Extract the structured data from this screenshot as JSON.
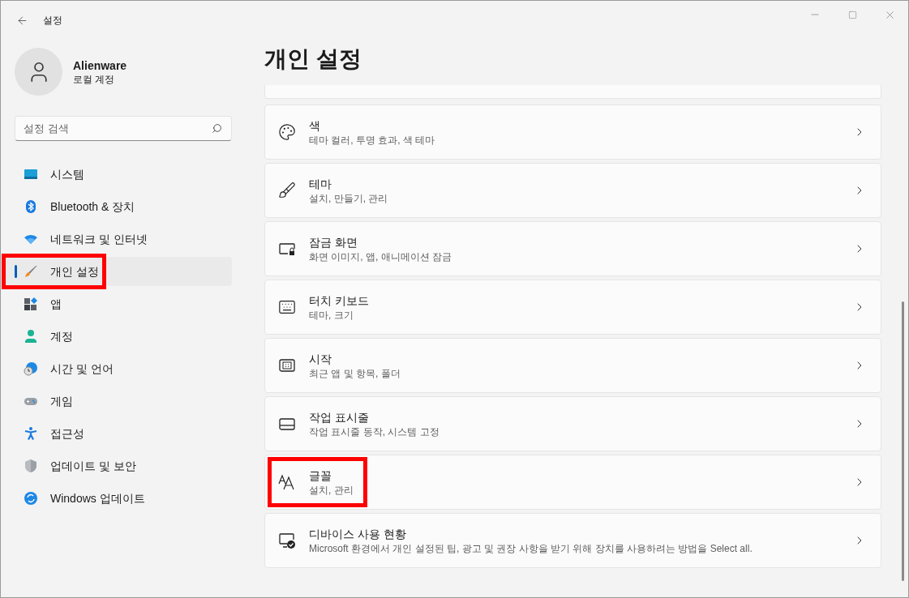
{
  "window": {
    "title": "설정"
  },
  "account": {
    "name": "Alienware",
    "type": "로컬 계정"
  },
  "search": {
    "placeholder": "설정 검색"
  },
  "sidebar": {
    "items": [
      {
        "label": "시스템",
        "kind": "system",
        "selected": false,
        "highlighted": false
      },
      {
        "label": "Bluetooth & 장치",
        "kind": "bluetooth",
        "selected": false,
        "highlighted": false
      },
      {
        "label": "네트워크 및 인터넷",
        "kind": "network",
        "selected": false,
        "highlighted": false
      },
      {
        "label": "개인 설정",
        "kind": "personalize",
        "selected": true,
        "highlighted": true
      },
      {
        "label": "앱",
        "kind": "apps",
        "selected": false,
        "highlighted": false
      },
      {
        "label": "계정",
        "kind": "account",
        "selected": false,
        "highlighted": false
      },
      {
        "label": "시간 및 언어",
        "kind": "time",
        "selected": false,
        "highlighted": false
      },
      {
        "label": "게임",
        "kind": "gaming",
        "selected": false,
        "highlighted": false
      },
      {
        "label": "접근성",
        "kind": "accessibility",
        "selected": false,
        "highlighted": false
      },
      {
        "label": "업데이트 및 보안",
        "kind": "security",
        "selected": false,
        "highlighted": false
      },
      {
        "label": "Windows 업데이트",
        "kind": "update",
        "selected": false,
        "highlighted": false
      }
    ]
  },
  "page": {
    "title": "개인 설정",
    "cards": [
      {
        "kind": "palette",
        "title": "색",
        "subtitle": "테마 컬러, 투명 효과, 색 테마",
        "highlighted": false
      },
      {
        "kind": "brush",
        "title": "테마",
        "subtitle": "설치, 만들기, 관리",
        "highlighted": false
      },
      {
        "kind": "lockscreen",
        "title": "잠금 화면",
        "subtitle": "화면 이미지, 앱, 애니메이션 잠금",
        "highlighted": false
      },
      {
        "kind": "keyboard",
        "title": "터치 키보드",
        "subtitle": "테마, 크기",
        "highlighted": false
      },
      {
        "kind": "start",
        "title": "시작",
        "subtitle": "최근 앱 및 항목, 폴더",
        "highlighted": false
      },
      {
        "kind": "taskbar",
        "title": "작업 표시줄",
        "subtitle": "작업 표시줄 동작, 시스템 고정",
        "highlighted": false
      },
      {
        "kind": "fonts",
        "title": "글꼴",
        "subtitle": "설치, 관리",
        "highlighted": true
      },
      {
        "kind": "device",
        "title": "디바이스 사용 현황",
        "subtitle": "Microsoft 환경에서 개인 설정된 팁, 광고 및 권장 사항을 받기 위해 장치를 사용하려는 방법을 Select all.",
        "highlighted": false
      }
    ]
  }
}
